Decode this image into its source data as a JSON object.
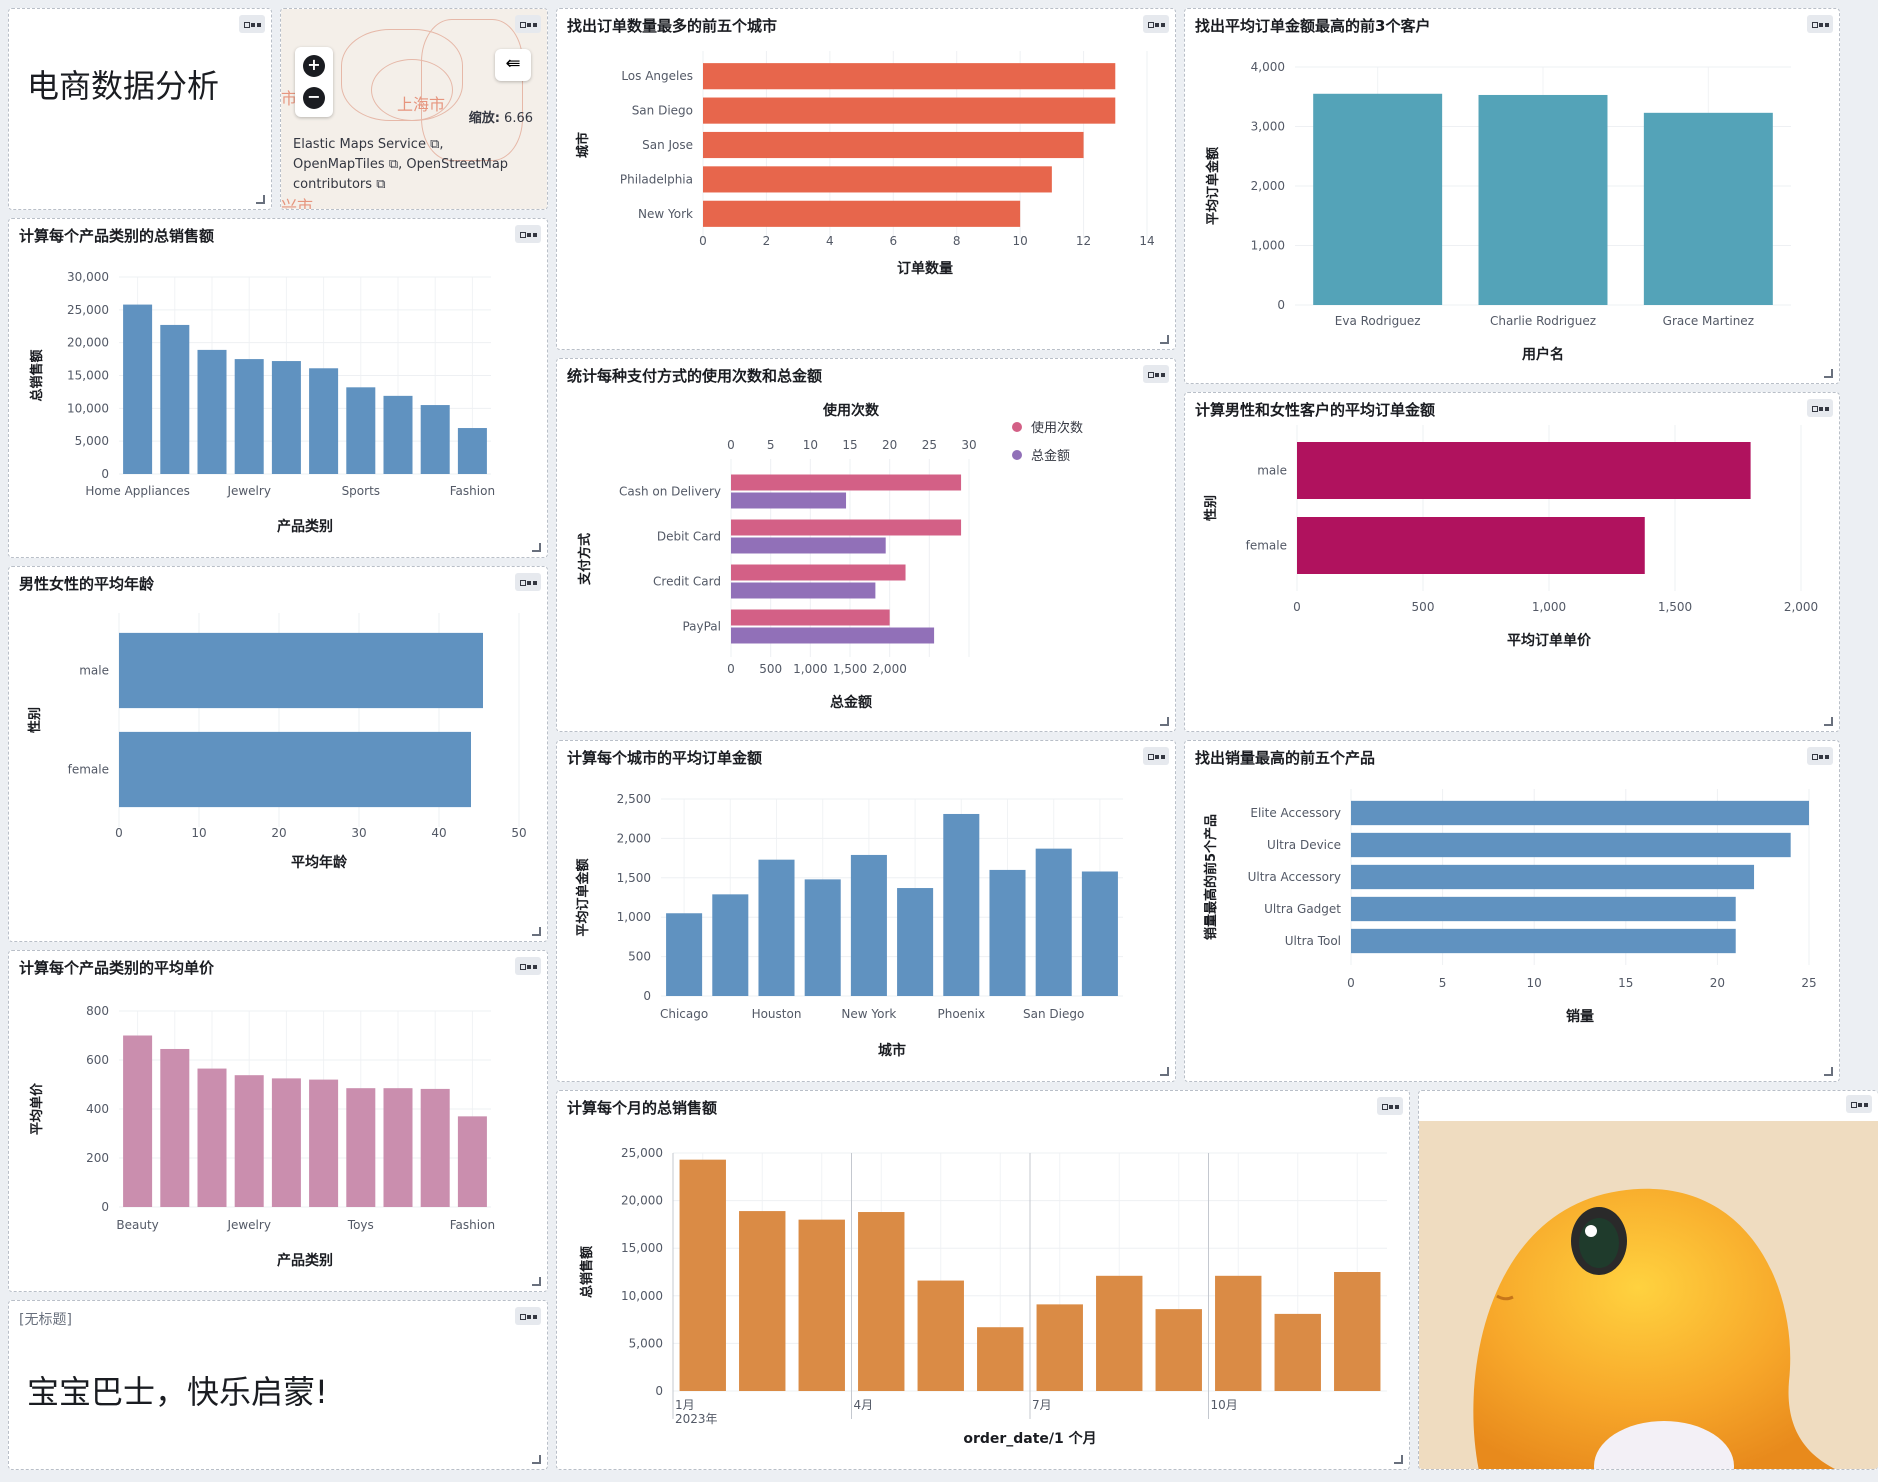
{
  "dashboard_title": "电商数据分析",
  "untitled_label": "[无标题]",
  "slogan": "宝宝巴士，快乐启蒙!",
  "map": {
    "city_label": "上海市",
    "city_label2": "兴市",
    "city_label3": "市",
    "zoom_label": "缩放:",
    "zoom_value": "6.66",
    "attribution_1": "Elastic Maps Service",
    "attribution_2": "OpenMapTiles",
    "attribution_3": "OpenStreetMap",
    "attribution_4": "contributors",
    "icons": [
      "plus-icon",
      "minus-icon",
      "layers-icon",
      "external-link-icon"
    ]
  },
  "colors": {
    "red": "#e7664c",
    "teal": "#54a3b8",
    "pink": "#d36086",
    "purple": "#9170b8",
    "magenta": "#b0125e",
    "blue": "#6092c0",
    "rose": "#ca8eae",
    "orange": "#da8b45"
  },
  "panels": {
    "top_cities": {
      "title": "找出订单数量最多的前五个城市"
    },
    "top_customers": {
      "title": "找出平均订单金额最高的前3个客户"
    },
    "category_sales": {
      "title": "计算每个产品类别的总销售额"
    },
    "payment": {
      "title": "统计每种支付方式的使用次数和总金额"
    },
    "gender_avg_order": {
      "title": "计算男性和女性客户的平均订单金额"
    },
    "gender_age": {
      "title": "男性女性的平均年龄"
    },
    "city_avg_order": {
      "title": "计算每个城市的平均订单金额"
    },
    "top_products": {
      "title": "找出销量最高的前五个产品"
    },
    "category_price": {
      "title": "计算每个产品类别的平均单价"
    },
    "monthly": {
      "title": "计算每个月的总销售额"
    }
  },
  "chart_data": [
    {
      "id": "top_cities",
      "type": "bar",
      "orientation": "horizontal",
      "categories": [
        "Los Angeles",
        "San Diego",
        "San Jose",
        "Philadelphia",
        "New York"
      ],
      "values": [
        13,
        13,
        12,
        11,
        10
      ],
      "xlabel": "订单数量",
      "ylabel": "城市",
      "xlim": [
        0,
        14
      ],
      "xticks": [
        "0",
        "2",
        "4",
        "6",
        "8",
        "10",
        "12",
        "14"
      ],
      "grid": true
    },
    {
      "id": "top_customers",
      "type": "bar",
      "categories": [
        "Eva Rodriguez",
        "Charlie Rodriguez",
        "Grace Martinez"
      ],
      "values": [
        3550,
        3530,
        3230
      ],
      "xlabel": "用户名",
      "ylabel": "平均订单金额",
      "ylim": [
        0,
        4000
      ],
      "yticks": [
        "0",
        "1,000",
        "2,000",
        "3,000",
        "4,000"
      ],
      "grid": true
    },
    {
      "id": "category_sales",
      "type": "bar",
      "categories": [
        "Home Appliances",
        "",
        "",
        "Jewelry",
        "",
        "",
        "Sports",
        "",
        "",
        "Fashion"
      ],
      "values": [
        25800,
        22700,
        18900,
        17500,
        17200,
        16100,
        13200,
        11900,
        10500,
        7000
      ],
      "xlabel": "产品类别",
      "ylabel": "总销售额",
      "ylim": [
        0,
        30000
      ],
      "yticks": [
        "0",
        "5,000",
        "10,000",
        "15,000",
        "20,000",
        "25,000",
        "30,000"
      ],
      "grid": true
    },
    {
      "id": "payment",
      "type": "bar",
      "orientation": "horizontal",
      "categories": [
        "Cash on Delivery",
        "Debit Card",
        "Credit Card",
        "PayPal"
      ],
      "series": [
        {
          "name": "使用次数",
          "values": [
            29,
            29,
            22,
            20
          ]
        },
        {
          "name": "总金额",
          "values": [
            1450,
            1950,
            1820,
            2560
          ]
        }
      ],
      "x_top_label": "使用次数",
      "x_top_ticks": [
        "0",
        "5",
        "10",
        "15",
        "20",
        "25",
        "30"
      ],
      "x_top_lim": [
        0,
        30
      ],
      "xlabel": "总金额",
      "x_bottom_ticks": [
        "0",
        "500",
        "1,000",
        "1,500",
        "2,000"
      ],
      "x_bottom_lim": [
        0,
        3000
      ],
      "ylabel": "支付方式",
      "legend": "top-right",
      "grid": true
    },
    {
      "id": "gender_avg_order",
      "type": "bar",
      "orientation": "horizontal",
      "categories": [
        "male",
        "female"
      ],
      "values": [
        1800,
        1380
      ],
      "xlabel": "平均订单单价",
      "ylabel": "性别",
      "xlim": [
        0,
        2000
      ],
      "xticks": [
        "0",
        "500",
        "1,000",
        "1,500",
        "2,000"
      ],
      "grid": true
    },
    {
      "id": "gender_age",
      "type": "bar",
      "orientation": "horizontal",
      "categories": [
        "male",
        "female"
      ],
      "values": [
        45.5,
        44
      ],
      "xlabel": "平均年龄",
      "ylabel": "性别",
      "xlim": [
        0,
        50
      ],
      "xticks": [
        "0",
        "10",
        "20",
        "30",
        "40",
        "50"
      ],
      "grid": true
    },
    {
      "id": "city_avg_order",
      "type": "bar",
      "categories": [
        "Chicago",
        "",
        "Houston",
        "",
        "New York",
        "",
        "Phoenix",
        "",
        "San Diego",
        ""
      ],
      "values": [
        1050,
        1290,
        1730,
        1480,
        1790,
        1370,
        2310,
        1600,
        1870,
        1580
      ],
      "xlabel": "城市",
      "ylabel": "平均订单金额",
      "ylim": [
        0,
        2500
      ],
      "yticks": [
        "0",
        "500",
        "1,000",
        "1,500",
        "2,000",
        "2,500"
      ],
      "grid": true
    },
    {
      "id": "top_products",
      "type": "bar",
      "orientation": "horizontal",
      "categories": [
        "Elite Accessory",
        "Ultra Device",
        "Ultra Accessory",
        "Ultra Gadget",
        "Ultra Tool"
      ],
      "values": [
        25,
        24,
        22,
        21,
        21
      ],
      "xlabel": "销量",
      "ylabel": "销量最高的前5个产品",
      "xlim": [
        0,
        25
      ],
      "xticks": [
        "0",
        "5",
        "10",
        "15",
        "20",
        "25"
      ],
      "grid": true
    },
    {
      "id": "category_price",
      "type": "bar",
      "categories": [
        "Beauty",
        "",
        "",
        "Jewelry",
        "",
        "",
        "Toys",
        "",
        "",
        "Fashion"
      ],
      "values": [
        700,
        645,
        565,
        538,
        525,
        520,
        485,
        485,
        482,
        370
      ],
      "xlabel": "产品类别",
      "ylabel": "平均单价",
      "ylim": [
        0,
        800
      ],
      "yticks": [
        "0",
        "200",
        "400",
        "600",
        "800"
      ],
      "grid": true
    },
    {
      "id": "monthly",
      "type": "bar",
      "categories": [
        "1月",
        "2月",
        "3月",
        "4月",
        "5月",
        "6月",
        "7月",
        "8月",
        "9月",
        "10月",
        "11月",
        "12月"
      ],
      "values": [
        24300,
        18900,
        18000,
        18800,
        11600,
        6700,
        9100,
        12100,
        8600,
        12100,
        8100,
        12500
      ],
      "xlabel": "order_date/1 个月",
      "ylabel": "总销售额",
      "ylim": [
        0,
        25000
      ],
      "yticks": [
        "0",
        "5,000",
        "10,000",
        "15,000",
        "20,000",
        "25,000"
      ],
      "x_tick_labels": [
        "1月",
        "4月",
        "7月",
        "10月"
      ],
      "x_tick_sub": "2023年",
      "grid": true
    }
  ]
}
